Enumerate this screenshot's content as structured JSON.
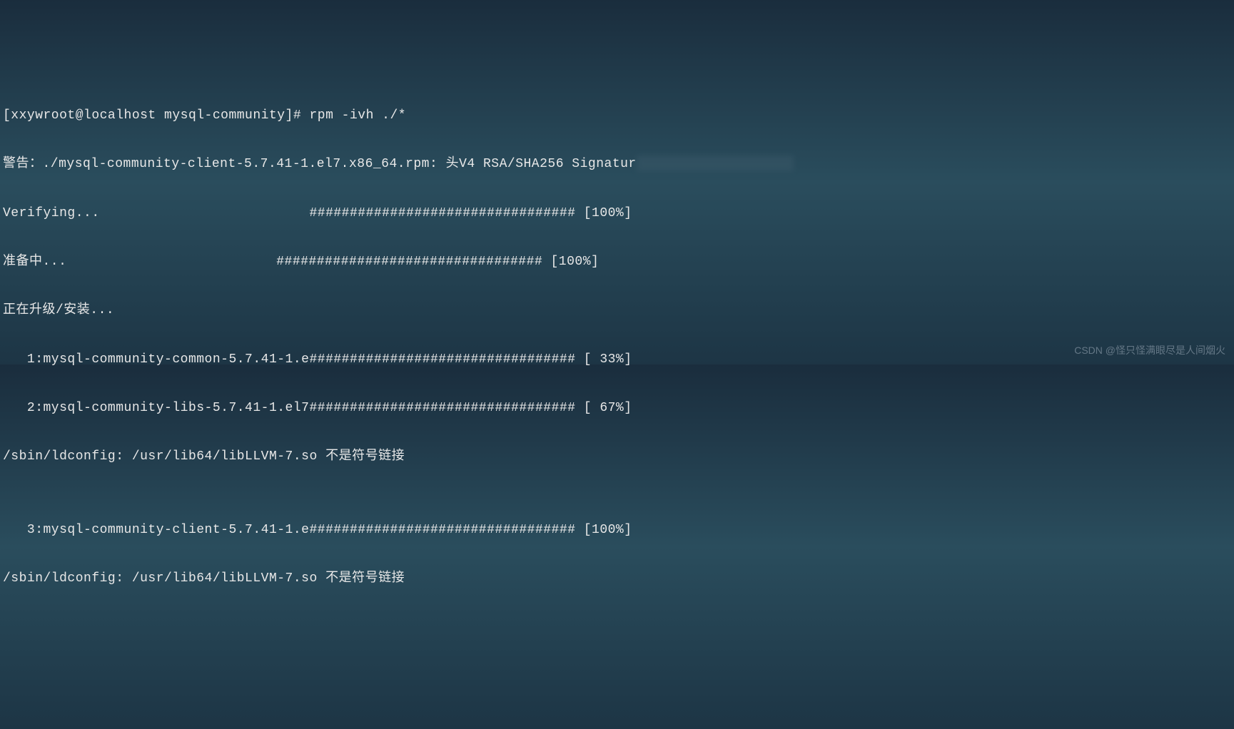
{
  "terminal": {
    "prompt_line": "[xxywroot@localhost mysql-community]# rpm -ivh ./*",
    "warning_prefix": "警告：./mysql-community-client-5.7.41-1.el7.x86_64.rpm: 头V4 RSA/SHA256 Signatur",
    "verifying": "Verifying...                          ################################# [100%]",
    "preparing": "准备中...                          ################################# [100%]",
    "upgrading": "正在升级/安装...",
    "pkg1": "   1:mysql-community-common-5.7.41-1.e################################# [ 33%]",
    "pkg2": "   2:mysql-community-libs-5.7.41-1.el7################################# [ 67%]",
    "ldconfig1": "/sbin/ldconfig: /usr/lib64/libLLVM-7.so 不是符号链接",
    "blank": "",
    "pkg3": "   3:mysql-community-client-5.7.41-1.e################################# [100%]",
    "ldconfig2": "/sbin/ldconfig: /usr/lib64/libLLVM-7.so 不是符号链接"
  },
  "watermark": "CSDN @怪只怪满眼尽是人间烟火"
}
